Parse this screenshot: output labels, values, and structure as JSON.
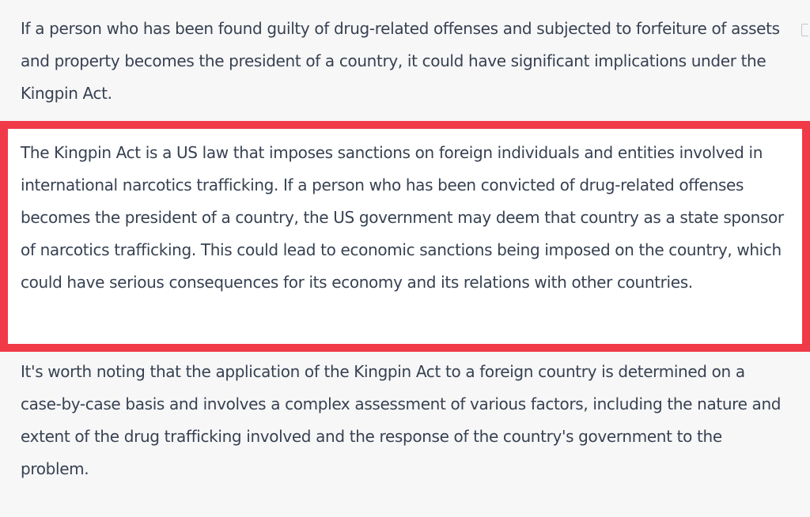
{
  "messages": [
    "If a person who has been found guilty of drug-related offenses and subjected to forfeiture of assets and property becomes the president of a country, it could have significant implications under the Kingpin Act.",
    "The Kingpin Act is a US law that imposes sanctions on foreign individuals and entities involved in international narcotics trafficking. If a person who has been convicted of drug-related offenses becomes the president of a country, the US government may deem that country as a state sponsor of narcotics trafficking. This could lead to economic sanctions being imposed on the country, which could have serious consequences for its economy and its relations with other countries.",
    "It's worth noting that the application of the Kingpin Act to a foreign country is determined on a case-by-case basis and involves a complex assessment of various factors, including the nature and extent of the drug trafficking involved and the response of the country's government to the problem."
  ],
  "colors": {
    "highlight_border": "#f03a47",
    "background": "#f7f7f8",
    "highlight_background": "#ffffff",
    "text": "#374151"
  },
  "icons": {
    "copy": "copy-icon"
  }
}
